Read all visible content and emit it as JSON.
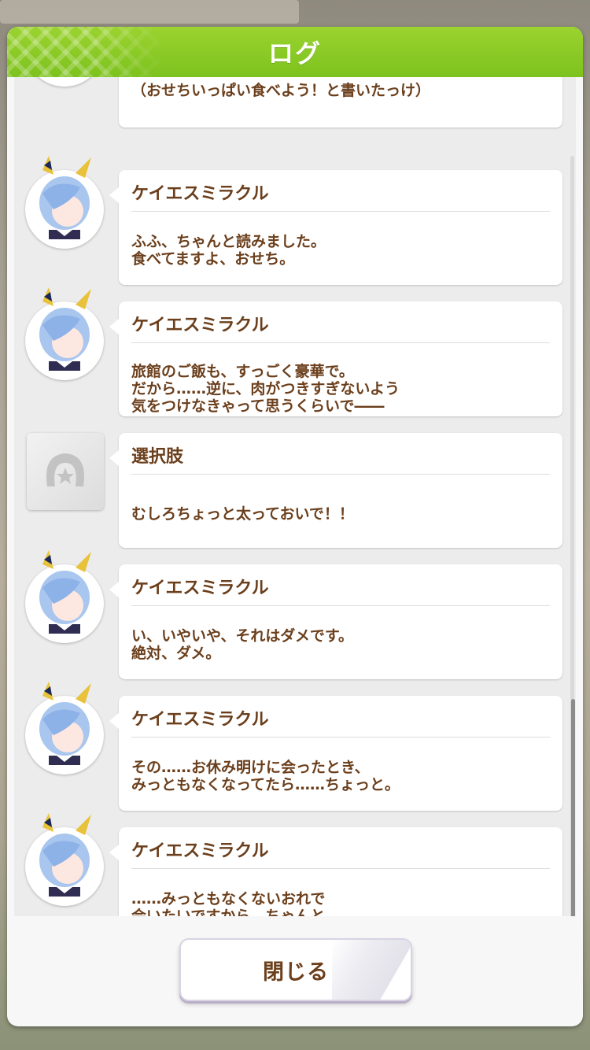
{
  "header": {
    "title": "ログ"
  },
  "log": {
    "first_partial_text": "（おせちいっぱい食べよう！と書いたっけ）",
    "entries": [
      {
        "speaker": "ケイエスミラクル",
        "text": "ふふ、ちゃんと読みました。\n食べてますよ、おせち。",
        "icon": "character-avatar"
      },
      {
        "speaker": "ケイエスミラクル",
        "text": "旅館のご飯も、すっごく豪華で。\nだから……逆に、肉がつきすぎないよう\n気をつけなきゃって思うくらいで――",
        "icon": "character-avatar"
      },
      {
        "speaker": "選択肢",
        "text": "むしろちょっと太っておいで！！",
        "icon": "horseshoe-choice-icon"
      },
      {
        "speaker": "ケイエスミラクル",
        "text": "い、いやいや、それはダメです。\n絶対、ダメ。",
        "icon": "character-avatar"
      },
      {
        "speaker": "ケイエスミラクル",
        "text": "その……お休み明けに会ったとき、\nみっともなくなってたら……ちょっと。",
        "icon": "character-avatar"
      },
      {
        "speaker": "ケイエスミラクル",
        "text": "……みっともなくないおれで\n会いたいですから、ちゃんと。",
        "icon": "character-avatar"
      }
    ]
  },
  "footer": {
    "close_label": "閉じる"
  },
  "colors": {
    "header_green": "#8ccb26",
    "text_brown": "#6b3f1c"
  }
}
